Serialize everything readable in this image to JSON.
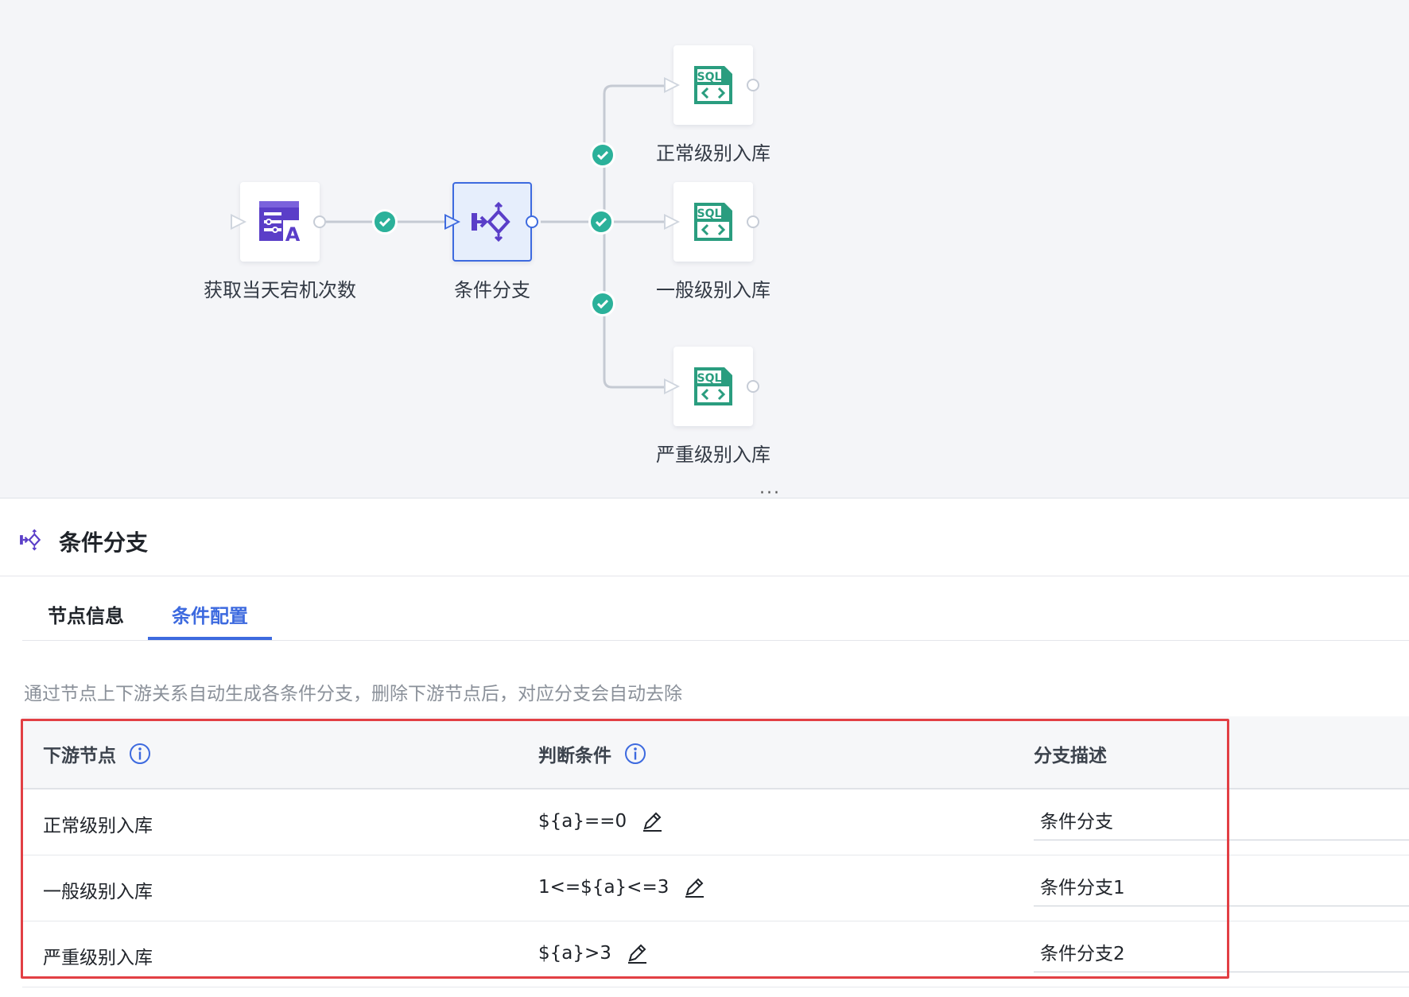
{
  "canvas": {
    "nodes": [
      {
        "id": "fetch",
        "label": "获取当天宕机次数"
      },
      {
        "id": "branch",
        "label": "条件分支"
      },
      {
        "id": "normal",
        "label": "正常级别入库"
      },
      {
        "id": "general",
        "label": "一般级别入库"
      },
      {
        "id": "severe",
        "label": "严重级别入库"
      }
    ],
    "sql_icon_text": "SQL",
    "resize_handle": "⋮"
  },
  "panel": {
    "title": "条件分支",
    "tabs": [
      {
        "label": "节点信息",
        "active": false
      },
      {
        "label": "条件配置",
        "active": true
      }
    ],
    "hint": "通过节点上下游关系自动生成各条件分支，删除下游节点后，对应分支会自动去除",
    "table": {
      "headers": [
        "下游节点",
        "判断条件",
        "分支描述"
      ],
      "rows": [
        {
          "node": "正常级别入库",
          "condition": "${a}==0",
          "description": "条件分支"
        },
        {
          "node": "一般级别入库",
          "condition": "1<=${a}<=3",
          "description": "条件分支1"
        },
        {
          "node": "严重级别入库",
          "condition": "${a}>3",
          "description": "条件分支2"
        }
      ]
    }
  },
  "colors": {
    "accent": "#3d6adf",
    "success": "#2bb19a",
    "sql_green": "#2a9d7f",
    "node_purple": "#5a3ec8",
    "highlight_red": "#e23f44"
  }
}
